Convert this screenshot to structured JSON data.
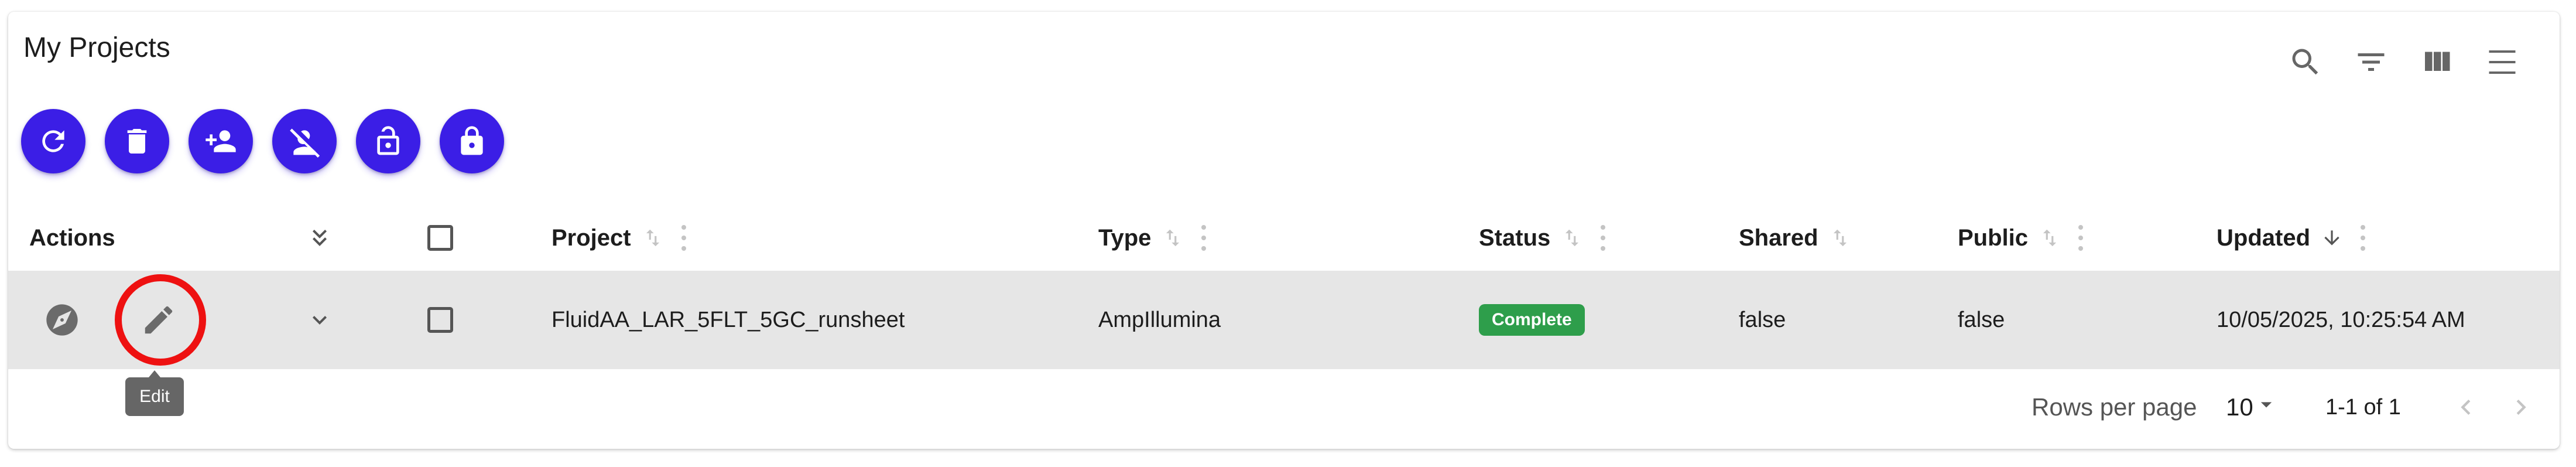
{
  "page": {
    "title": "My Projects"
  },
  "toolbar_icons": [
    "search-icon",
    "filter-icon",
    "columns-icon",
    "density-icon"
  ],
  "action_buttons": [
    {
      "name": "refresh-button",
      "icon": "refresh-icon"
    },
    {
      "name": "delete-button",
      "icon": "trash-icon"
    },
    {
      "name": "add-user-button",
      "icon": "person-add-icon"
    },
    {
      "name": "remove-user-button",
      "icon": "person-off-icon"
    },
    {
      "name": "unlock-button",
      "icon": "lock-open-icon"
    },
    {
      "name": "lock-button",
      "icon": "lock-icon"
    }
  ],
  "table": {
    "headers": {
      "actions": "Actions",
      "project": "Project",
      "type": "Type",
      "status": "Status",
      "shared": "Shared",
      "public": "Public",
      "updated": "Updated"
    },
    "rows": [
      {
        "project": "FluidAA_LAR_5FLT_5GC_runsheet",
        "type": "AmpIllumina",
        "status": "Complete",
        "shared": "false",
        "public": "false",
        "updated": "10/05/2025, 10:25:54 AM"
      }
    ]
  },
  "tooltip": {
    "text": "Edit"
  },
  "pagination": {
    "rows_per_page_label": "Rows per page",
    "rows_per_page_value": "10",
    "range": "1-1 of 1"
  },
  "colors": {
    "primary": "#3b1ee6",
    "status_complete": "#2e9e4b",
    "highlight": "#ee1111",
    "row_background": "#e6e6e6"
  }
}
